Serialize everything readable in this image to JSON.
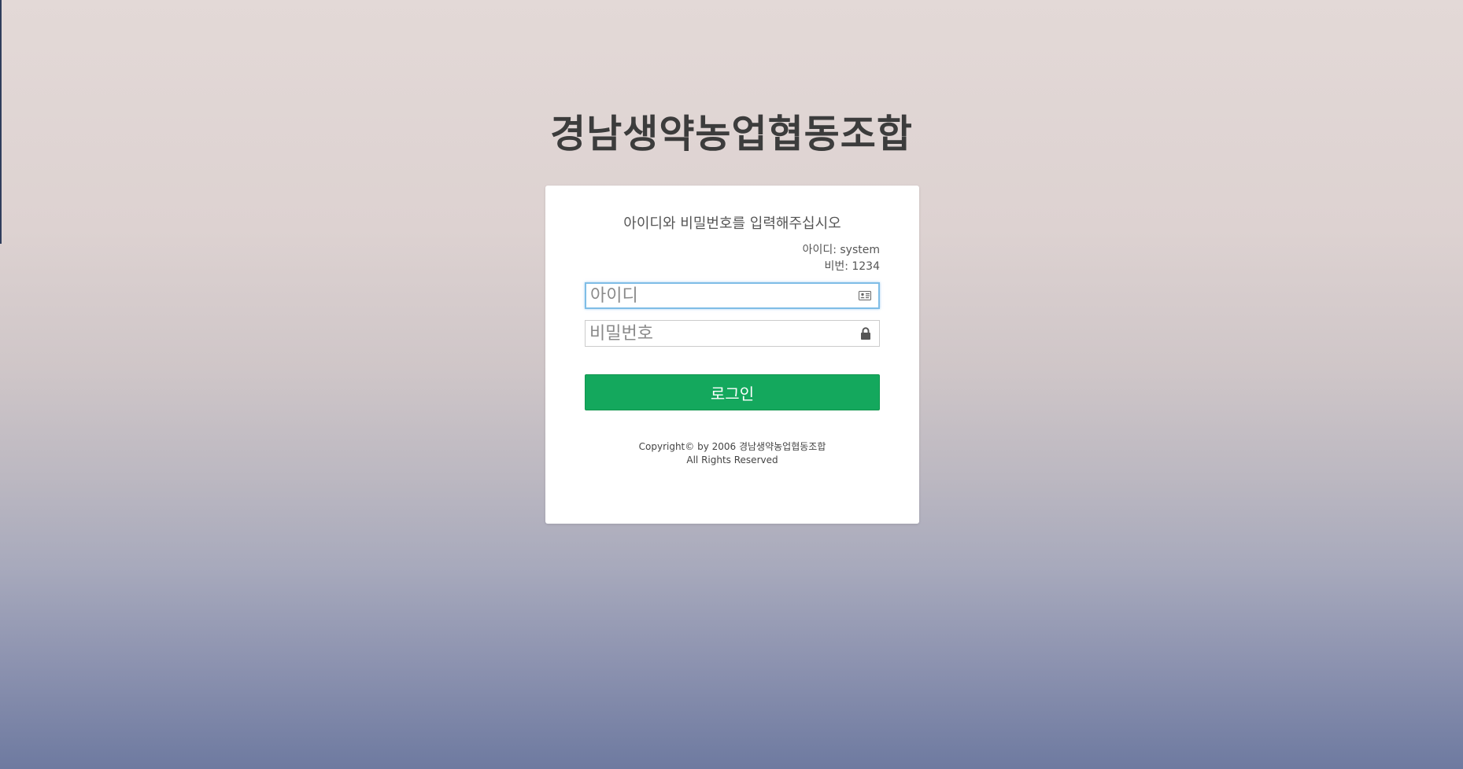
{
  "app": {
    "title": "경남생약농업협동조합"
  },
  "login": {
    "instruction": "아이디와 비밀번호를 입력해주십시오",
    "hint_id": "아이디: system",
    "hint_pw": "비번: 1234",
    "username_placeholder": "아이디",
    "password_placeholder": "비밀번호",
    "username_icon": "id-card-icon",
    "password_icon": "lock-icon",
    "submit_label": "로그인"
  },
  "footer": {
    "copyright_line1": "Copyright© by 2006 경남생약농업협동조합",
    "copyright_line2": "All Rights Reserved"
  },
  "colors": {
    "primary_button": "#14a85d",
    "focus_border": "#7fbde6",
    "title_text": "#3c3c3c"
  }
}
